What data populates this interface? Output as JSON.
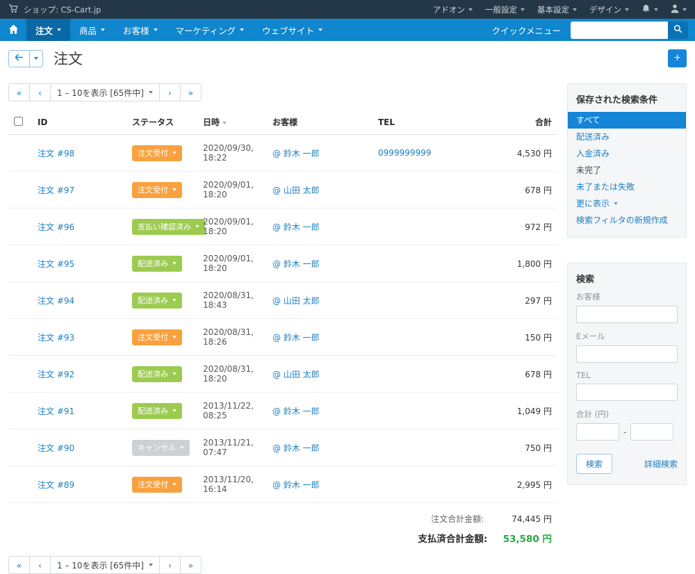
{
  "colors": {
    "topbar_bg": "#243746",
    "navbar_bg": "#0f86cd",
    "navbar_active_bg": "#0a68a6",
    "accent_blue": "#1585d8",
    "link_blue": "#1b7fc4",
    "status_orange": "#f9a13e",
    "status_green": "#9ccb50",
    "status_gray": "#ccd1d6",
    "paid_total_green": "#28a745"
  },
  "icons": {
    "add": "+",
    "first": "«",
    "prev": "‹",
    "next": "›",
    "last": "»"
  },
  "topbar": {
    "shop_label": "ショップ: CS-Cart.jp",
    "menus": [
      {
        "label": "アドオン"
      },
      {
        "label": "一般設定"
      },
      {
        "label": "基本設定"
      },
      {
        "label": "デザイン"
      }
    ]
  },
  "navbar": {
    "items": [
      {
        "label": "注文",
        "active": true
      },
      {
        "label": "商品"
      },
      {
        "label": "お客様"
      },
      {
        "label": "マーケティング"
      },
      {
        "label": "ウェブサイト"
      }
    ],
    "quick_menu_label": "クイックメニュー",
    "search_value": ""
  },
  "page": {
    "title": "注文"
  },
  "pagination": {
    "range_label": "1 – 10を表示 [65件中]"
  },
  "table": {
    "headers": {
      "id": "ID",
      "status": "ステータス",
      "datetime": "日時",
      "customer": "お客様",
      "tel": "TEL",
      "total": "合計"
    },
    "rows": [
      {
        "id": "注文 #98",
        "status": "注文受付",
        "status_type": "orange",
        "datetime": "2020/09/30, 18:22",
        "customer": "@ 鈴木 一郎",
        "tel": "0999999999",
        "total": "4,530 円"
      },
      {
        "id": "注文 #97",
        "status": "注文受付",
        "status_type": "orange",
        "datetime": "2020/09/01, 18:20",
        "customer": "@ 山田 太郎",
        "tel": "",
        "total": "678 円"
      },
      {
        "id": "注文 #96",
        "status": "支払い確認済み",
        "status_type": "green",
        "datetime": "2020/09/01, 18:20",
        "customer": "@ 鈴木 一郎",
        "tel": "",
        "total": "972 円"
      },
      {
        "id": "注文 #95",
        "status": "配送済み",
        "status_type": "green",
        "datetime": "2020/09/01, 18:20",
        "customer": "@ 鈴木 一郎",
        "tel": "",
        "total": "1,800 円"
      },
      {
        "id": "注文 #94",
        "status": "配送済み",
        "status_type": "green",
        "datetime": "2020/08/31, 18:43",
        "customer": "@ 山田 太郎",
        "tel": "",
        "total": "297 円"
      },
      {
        "id": "注文 #93",
        "status": "注文受付",
        "status_type": "orange",
        "datetime": "2020/08/31, 18:26",
        "customer": "@ 鈴木 一郎",
        "tel": "",
        "total": "150 円"
      },
      {
        "id": "注文 #92",
        "status": "配送済み",
        "status_type": "green",
        "datetime": "2020/08/31, 18:20",
        "customer": "@ 山田 太郎",
        "tel": "",
        "total": "678 円"
      },
      {
        "id": "注文 #91",
        "status": "配送済み",
        "status_type": "green",
        "datetime": "2013/11/22, 08:25",
        "customer": "@ 鈴木 一郎",
        "tel": "",
        "total": "1,049 円"
      },
      {
        "id": "注文 #90",
        "status": "キャンセル",
        "status_type": "gray",
        "datetime": "2013/11/21, 07:47",
        "customer": "@ 鈴木 一郎",
        "tel": "",
        "total": "750 円"
      },
      {
        "id": "注文 #89",
        "status": "注文受付",
        "status_type": "orange",
        "datetime": "2013/11/20, 16:14",
        "customer": "@ 鈴木 一郎",
        "tel": "",
        "total": "2,995 円"
      }
    ]
  },
  "totals": {
    "order_total_label": "注文合計金額:",
    "order_total_value": "74,445 円",
    "paid_total_label": "支払済合計金額:",
    "paid_total_value": "53,580 円"
  },
  "sidebar": {
    "saved_searches": {
      "title": "保存された検索条件",
      "items": [
        {
          "label": "すべて",
          "active": true
        },
        {
          "label": "配送済み"
        },
        {
          "label": "入金済み"
        },
        {
          "label": "未完了",
          "muted": true
        },
        {
          "label": "未了または失敗"
        },
        {
          "label": "更に表示",
          "caret": true
        },
        {
          "label": "検索フィルタの新規作成"
        }
      ]
    },
    "search": {
      "title": "検索",
      "customer_label": "お客様",
      "customer_value": "",
      "email_label": "Eメール",
      "email_value": "",
      "tel_label": "TEL",
      "tel_value": "",
      "total_label": "合計 (円)",
      "total_min_value": "",
      "total_max_value": "",
      "range_separator": "-",
      "search_button": "検索",
      "advanced_link": "詳細検索"
    }
  }
}
